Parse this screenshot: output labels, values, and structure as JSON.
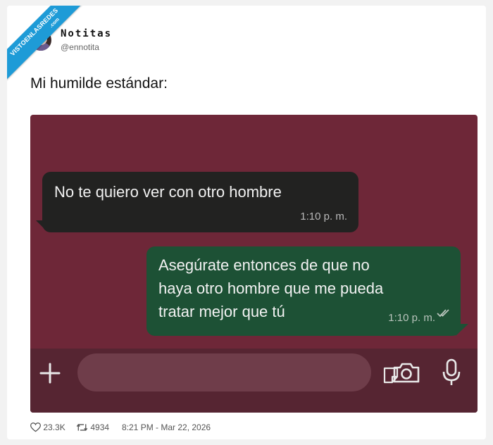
{
  "watermark": {
    "line1": "VISTOENLASREDES",
    "line2": ".com"
  },
  "author": {
    "display_name": "Notitas",
    "handle": "@ennotita"
  },
  "tweet": {
    "text": "Mi humilde estándar:"
  },
  "chat": {
    "incoming": {
      "text": "No te quiero ver con otro hombre",
      "time": "1:10 p. m."
    },
    "outgoing": {
      "lines": [
        "Asegúrate entonces de que no",
        "haya otro hombre que me pueda",
        "tratar mejor que tú"
      ],
      "time": "1:10 p. m.",
      "status_icon": "double-check-icon"
    },
    "input_bar": {
      "icons": [
        "plus-icon",
        "sticker-icon",
        "camera-icon",
        "microphone-icon"
      ]
    },
    "colors": {
      "background": "#6e2738",
      "incoming_bubble": "#222221",
      "outgoing_bubble": "#1d5135"
    }
  },
  "footer": {
    "likes": "23.3K",
    "retweets": "4934",
    "timestamp": "8:21 PM - Mar 22, 2026"
  }
}
